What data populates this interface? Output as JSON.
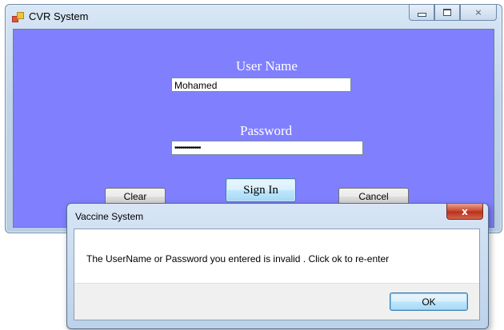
{
  "main_window": {
    "title": "CVR System",
    "icon": "app-window-icon",
    "caption_buttons": {
      "minimize_icon": "minimize-icon",
      "maximize_icon": "maximize-icon",
      "close_glyph": "⨯"
    }
  },
  "form": {
    "username_label": "User Name",
    "username_value": "Mohamed",
    "password_label": "Password",
    "password_value": "•••••••••••••",
    "signin_label": "Sign In",
    "clear_label": "Clear",
    "cancel_label": "Cancel",
    "background_color": "#8080ff"
  },
  "dialog": {
    "title": "Vaccine System",
    "close_glyph": "x",
    "message": "The UserName or Password you entered is invalid . Click ok to re-enter",
    "ok_label": "OK"
  }
}
